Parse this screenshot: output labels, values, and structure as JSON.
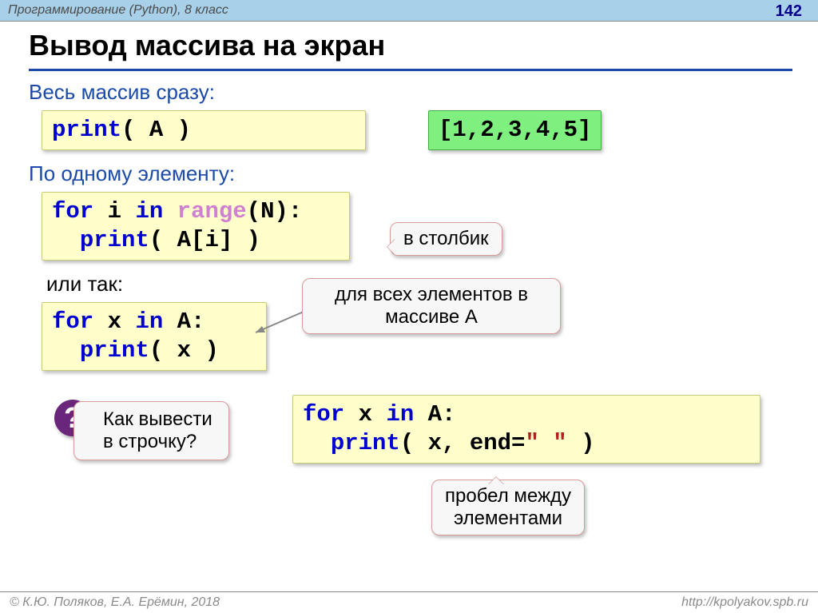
{
  "header": {
    "course": "Программирование (Python), 8 класс",
    "page": "142"
  },
  "footer": {
    "authors": "К.Ю. Поляков, Е.А. Ерёмин, 2018",
    "site": "http://kpolyakov.spb.ru"
  },
  "title": "Вывод массива на экран",
  "section1": {
    "heading": "Весь массив сразу:",
    "code": {
      "print_kw": "print",
      "open": "( ",
      "var": "A",
      "close": " )"
    },
    "output": "[1,2,3,4,5]"
  },
  "section2": {
    "heading": "По одному элементу:",
    "code": {
      "l1_for": "for",
      "l1_i": " i ",
      "l1_in": "in",
      "l1_sp": " ",
      "l1_range": "range",
      "l1_args": "(N):",
      "l2_indent": "  ",
      "l2_print": "print",
      "l2_open": "( ",
      "l2_expr": "A[i]",
      "l2_close": " )"
    },
    "callout": "в столбик",
    "alt_label": "или так:",
    "alt_code": {
      "l1_for": "for",
      "l1_x": " x ",
      "l1_in": "in",
      "l1_rest": " A:",
      "l2_indent": "  ",
      "l2_print": "print",
      "l2_open": "( ",
      "l2_x": "x",
      "l2_close": " )"
    },
    "alt_callout_l1": "для всех элементов в",
    "alt_callout_l2": "массиве A"
  },
  "question": {
    "mark": "?",
    "line1": "Как вывести",
    "line2": "в строчку?"
  },
  "answer": {
    "code": {
      "l1_for": "for",
      "l1_x": " x ",
      "l1_in": "in",
      "l1_rest": " A:",
      "l2_indent": "  ",
      "l2_print": "print",
      "l2_open": "( ",
      "l2_x": "x",
      "l2_comma": ", end=",
      "l2_str": "\" \"",
      "l2_close": " )"
    },
    "callout_l1": "пробел между",
    "callout_l2": "элементами"
  }
}
